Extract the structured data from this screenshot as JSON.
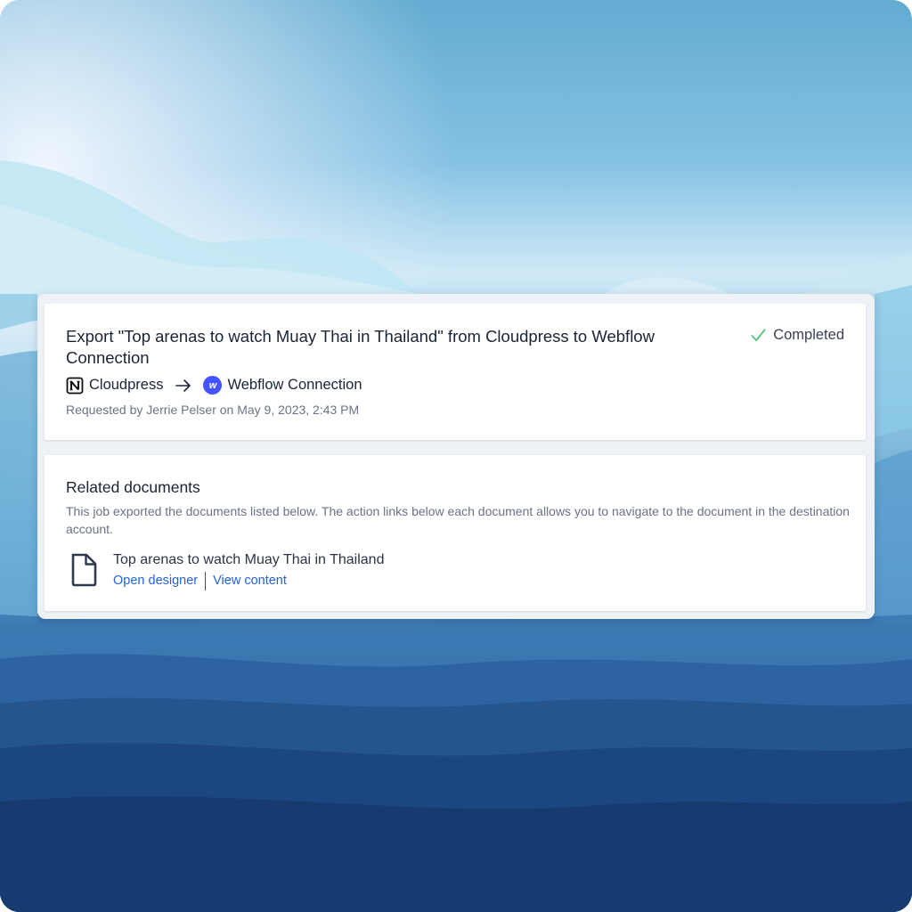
{
  "job": {
    "title": "Export \"Top arenas to watch Muay Thai in Thailand\" from Cloudpress to Webflow Connection",
    "status": "Completed",
    "source": "Cloudpress",
    "source_icon": "notion-icon",
    "destination": "Webflow Connection",
    "destination_icon": "webflow-icon",
    "destination_icon_letter": "w",
    "requested_by": "Requested by Jerrie Pelser on May 9, 2023, 2:43 PM"
  },
  "related": {
    "title": "Related documents",
    "description": "This job exported the documents listed below. The action links below each document allows you to navigate to the document in the destination account.",
    "documents": [
      {
        "name": "Top arenas to watch Muay Thai in Thailand",
        "icon": "file-icon",
        "actions": [
          "Open designer",
          "View content"
        ]
      }
    ]
  },
  "colors": {
    "status_check": "#4cc37d",
    "link": "#2563d8",
    "webflow_brand": "#4353ff"
  }
}
